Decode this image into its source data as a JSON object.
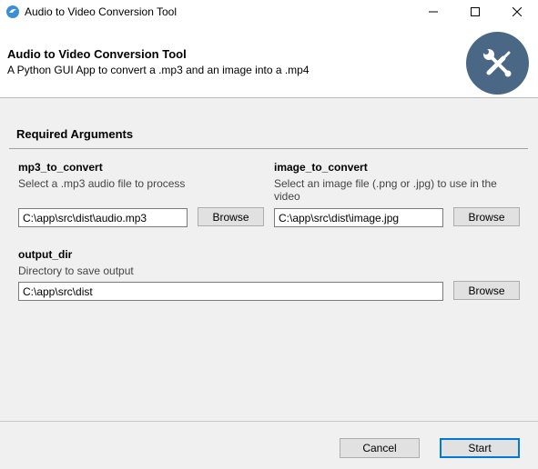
{
  "window": {
    "title": "Audio to Video Conversion Tool",
    "controls": [
      "minimize",
      "maximize",
      "close"
    ]
  },
  "header": {
    "title": "Audio to Video Conversion Tool",
    "subtitle": "A Python GUI App to convert a .mp3 and an image into a .mp4",
    "logo_icon": "tools-icon",
    "logo_color": "#4a6785"
  },
  "section": {
    "title": "Required Arguments"
  },
  "fields": {
    "mp3": {
      "label": "mp3_to_convert",
      "help": "Select a .mp3 audio file to process",
      "value": "C:\\app\\src\\dist\\audio.mp3",
      "browse": "Browse"
    },
    "image": {
      "label": "image_to_convert",
      "help": "Select an image file (.png or .jpg) to use in the video",
      "value": "C:\\app\\src\\dist\\image.jpg",
      "browse": "Browse"
    },
    "output": {
      "label": "output_dir",
      "help": "Directory to save output",
      "value": "C:\\app\\src\\dist",
      "browse": "Browse"
    }
  },
  "footer": {
    "cancel": "Cancel",
    "start": "Start",
    "primary_color": "#0078d7"
  }
}
